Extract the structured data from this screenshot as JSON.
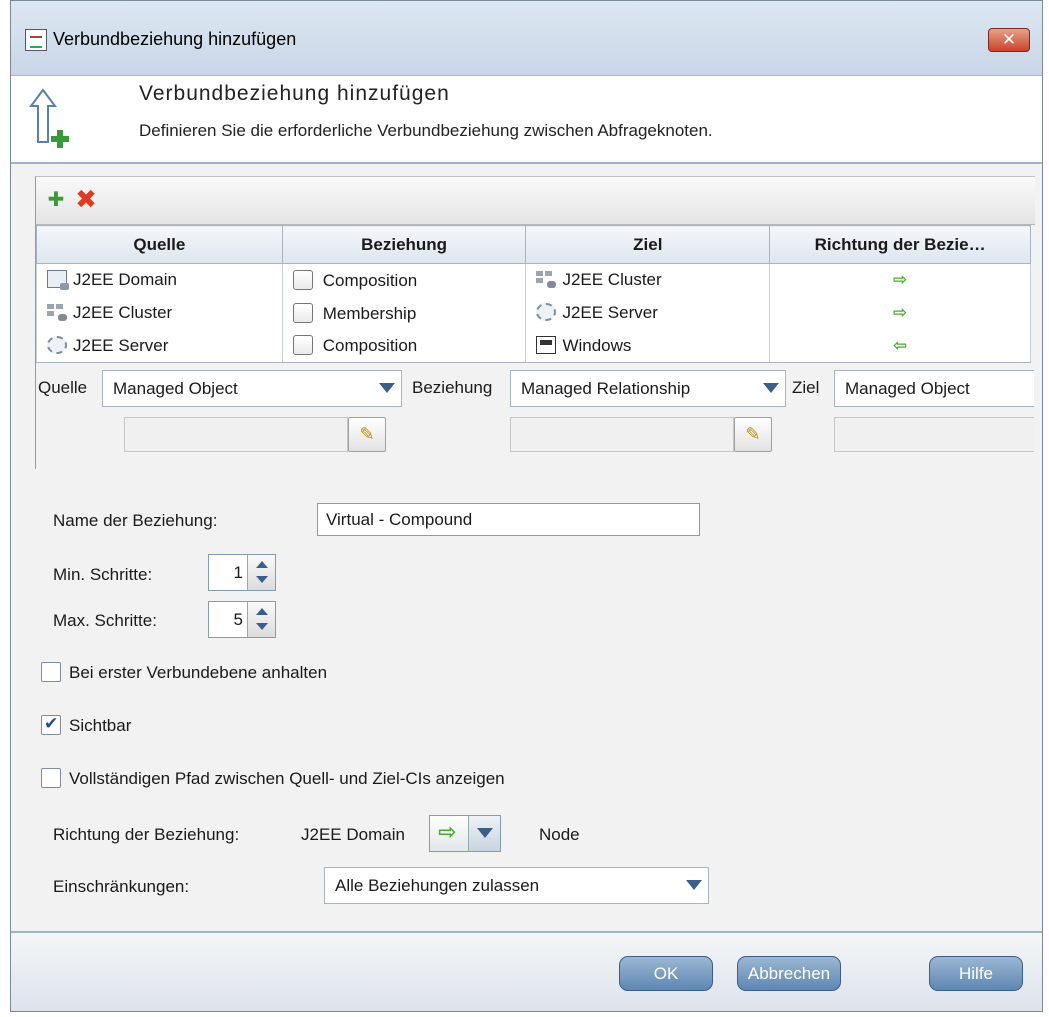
{
  "window": {
    "title": "Verbundbeziehung hinzufügen",
    "close_label": "✕"
  },
  "header": {
    "title": "Verbundbeziehung hinzufügen",
    "subtitle": "Definieren Sie die erforderliche Verbundbeziehung zwischen Abfrageknoten."
  },
  "table": {
    "columns": [
      "Quelle",
      "Beziehung",
      "Ziel",
      "Richtung der Bezie…"
    ],
    "rows": [
      {
        "source": "J2EE Domain",
        "source_icon": "domain-icon",
        "relation": "Composition",
        "target": "J2EE Cluster",
        "target_icon": "cluster-icon",
        "direction": "⇨",
        "direction_name": "arrow-right-icon"
      },
      {
        "source": "J2EE Cluster",
        "source_icon": "cluster-icon",
        "relation": "Membership",
        "target": "J2EE Server",
        "target_icon": "server-icon",
        "direction": "⇨",
        "direction_name": "arrow-right-icon"
      },
      {
        "source": "J2EE Server",
        "source_icon": "server-icon",
        "relation": "Composition",
        "target": "Windows",
        "target_icon": "windows-icon",
        "direction": "⇦",
        "direction_name": "arrow-left-icon"
      }
    ]
  },
  "selectors": {
    "source_label": "Quelle",
    "source_value": "Managed Object",
    "relation_label": "Beziehung",
    "relation_value": "Managed Relationship",
    "target_label": "Ziel",
    "target_value": "Managed Object"
  },
  "form": {
    "name_label": "Name der Beziehung:",
    "name_value": "Virtual - Compound",
    "min_label": "Min. Schritte:",
    "min_value": "1",
    "max_label": "Max. Schritte:",
    "max_value": "5",
    "stop_label": "Bei erster Verbundebene anhalten",
    "stop_checked": false,
    "visible_label": "Sichtbar",
    "visible_checked": true,
    "fullpath_label": "Vollständigen Pfad zwischen Quell- und Ziel-CIs anzeigen",
    "fullpath_checked": false,
    "direction_label": "Richtung der Beziehung:",
    "direction_source": "J2EE Domain",
    "direction_arrow": "⇨",
    "direction_target": "Node",
    "restrictions_label": "Einschränkungen:",
    "restrictions_value": "Alle Beziehungen zulassen"
  },
  "buttons": {
    "ok": "OK",
    "cancel": "Abbrechen",
    "help": "Hilfe"
  },
  "colors": {
    "accent": "#5f87b3",
    "arrow": "#4aae2a",
    "delete": "#e23a1a"
  }
}
